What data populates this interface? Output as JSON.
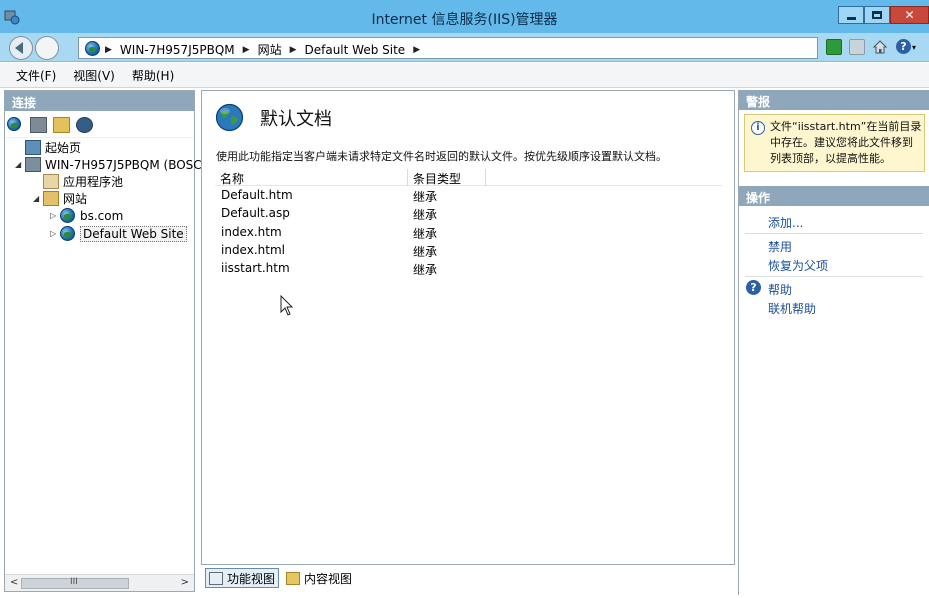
{
  "window": {
    "title": "Internet 信息服务(IIS)管理器",
    "minimize_icon": "minimize-icon",
    "maximize_icon": "maximize-icon",
    "close_icon": "close-icon"
  },
  "address": {
    "crumbs": [
      "WIN-7H957J5PBQM",
      "网站",
      "Default Web Site"
    ],
    "separator": "▶"
  },
  "menu": {
    "items": [
      "文件(F)",
      "视图(V)",
      "帮助(H)"
    ]
  },
  "connections": {
    "header": "连接",
    "tree": [
      {
        "label": "起始页",
        "expander": ""
      },
      {
        "label": "WIN-7H957J5PBQM (BOSC",
        "expander": "◢"
      },
      {
        "label": "应用程序池",
        "expander": ""
      },
      {
        "label": "网站",
        "expander": "◢"
      },
      {
        "label": "bs.com",
        "expander": "▷"
      },
      {
        "label": "Default Web Site",
        "expander": "▷",
        "selected": true
      }
    ],
    "scroll_grip": "III"
  },
  "feature": {
    "title": "默认文档",
    "description": "使用此功能指定当客户端未请求特定文件名时返回的默认文件。按优先级顺序设置默认文档。",
    "columns": [
      "名称",
      "条目类型"
    ],
    "rows": [
      [
        "Default.htm",
        "继承"
      ],
      [
        "Default.asp",
        "继承"
      ],
      [
        "index.htm",
        "继承"
      ],
      [
        "index.html",
        "继承"
      ],
      [
        "iisstart.htm",
        "继承"
      ]
    ]
  },
  "view_tabs": {
    "features": "功能视图",
    "content": "内容视图"
  },
  "alerts": {
    "header": "警报",
    "message": "文件“iisstart.htm”在当前目录中存在。建议您将此文件移到列表顶部，以提高性能。"
  },
  "actions": {
    "header": "操作",
    "add": "添加...",
    "disable": "禁用",
    "revert": "恢复为父项",
    "help": "帮助",
    "online_help": "联机帮助"
  }
}
